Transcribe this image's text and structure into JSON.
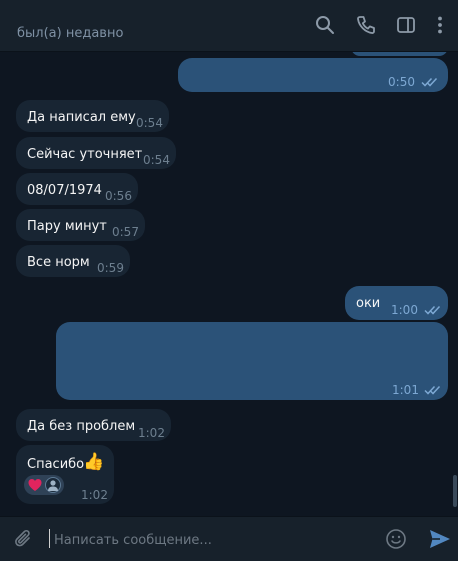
{
  "header": {
    "status": "был(а) недавно",
    "icons": [
      "search-icon",
      "phone-icon",
      "sidebar-icon",
      "more-vertical-icon"
    ]
  },
  "messages": {
    "m1": {
      "direction": "out",
      "text": "",
      "time": "0:50",
      "read": true
    },
    "m2": {
      "direction": "in",
      "text": "Да написал ему",
      "time": "0:54"
    },
    "m3": {
      "direction": "in",
      "text": "Сейчас уточняет",
      "time": "0:54"
    },
    "m4": {
      "direction": "in",
      "text": "08/07/1974",
      "time": "0:56"
    },
    "m5": {
      "direction": "in",
      "text": "Пару минут",
      "time": "0:57"
    },
    "m6": {
      "direction": "in",
      "text": "Все норм",
      "time": "0:59"
    },
    "m7": {
      "direction": "out",
      "text": "оки",
      "time": "1:00",
      "read": true
    },
    "m8": {
      "direction": "out",
      "text": "",
      "time": "1:01",
      "read": true
    },
    "m9": {
      "direction": "in",
      "text": "Да без проблем",
      "time": "1:02"
    },
    "m10": {
      "direction": "in",
      "text": "Спасибо",
      "emoji": "👍",
      "time": "1:02",
      "reactions": [
        "heart",
        "avatar"
      ]
    }
  },
  "compose": {
    "placeholder": "Написать сообщение...",
    "value": ""
  },
  "colors": {
    "background": "#0e1621",
    "panel": "#17212b",
    "incoming": "#182533",
    "outgoing": "#2b5278",
    "accent": "#5288c1",
    "reaction_heart": "#e0245e"
  }
}
